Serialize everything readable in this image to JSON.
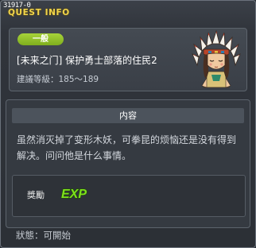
{
  "window": {
    "quest_id": "31917-0",
    "title": "QUEST INFO"
  },
  "header": {
    "category": "一般",
    "quest_name": "[未来之门] 保护勇士部落的住民2",
    "level_range": "建議等級：185～189",
    "npc_portrait_icon": "chieftain-portrait-icon"
  },
  "content": {
    "header": "内容",
    "description": "虽然消灭掉了变形木妖，可拳昆的烦恼还是没有得到解决。问问他是什么事情。",
    "reward_label": "獎勵",
    "reward_icon": "exp-icon",
    "reward_icon_text": "EXP"
  },
  "status": {
    "label": "狀態：可開始"
  },
  "colors": {
    "title": "#f2d64b",
    "badge": "#8fc026",
    "exp_green": "#7ee01d"
  }
}
